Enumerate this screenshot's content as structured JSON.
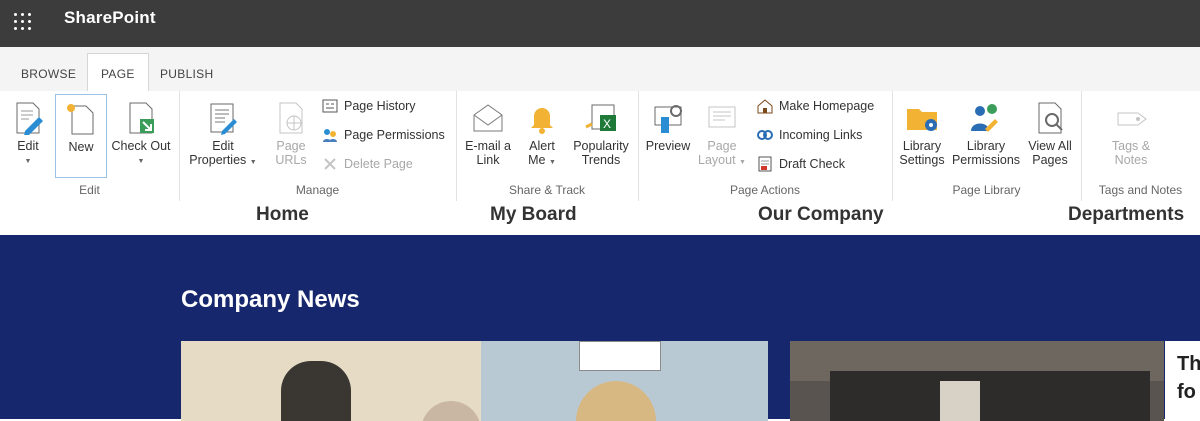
{
  "suite": {
    "app_name": "SharePoint"
  },
  "tabs": [
    {
      "label": "BROWSE",
      "active": false
    },
    {
      "label": "PAGE",
      "active": true
    },
    {
      "label": "PUBLISH",
      "active": false
    }
  ],
  "ribbon": {
    "edit_group": {
      "label": "Edit",
      "edit": "Edit",
      "new": "New",
      "check_out": "Check Out"
    },
    "manage_group": {
      "label": "Manage",
      "edit_properties_1": "Edit",
      "edit_properties_2": "Properties",
      "page_urls_1": "Page",
      "page_urls_2": "URLs",
      "page_history": "Page History",
      "page_permissions": "Page Permissions",
      "delete_page": "Delete Page"
    },
    "share_group": {
      "label": "Share & Track",
      "email_1": "E-mail a",
      "email_2": "Link",
      "alert_1": "Alert",
      "alert_2": "Me",
      "popularity_1": "Popularity",
      "popularity_2": "Trends"
    },
    "actions_group": {
      "label": "Page Actions",
      "preview": "Preview",
      "layout_1": "Page",
      "layout_2": "Layout",
      "make_homepage": "Make Homepage",
      "incoming_links": "Incoming Links",
      "draft_check": "Draft Check"
    },
    "library_group": {
      "label": "Page Library",
      "settings_1": "Library",
      "settings_2": "Settings",
      "permissions_1": "Library",
      "permissions_2": "Permissions",
      "view_all_1": "View All",
      "view_all_2": "Pages"
    },
    "tags_group": {
      "label": "Tags and Notes",
      "tags_1": "Tags &",
      "tags_2": "Notes"
    }
  },
  "nav": {
    "items": [
      "Home",
      "My Board",
      "Our Company",
      "Departments"
    ]
  },
  "hero": {
    "title": "Company News",
    "card2_text_1": "Th",
    "card2_text_2": "fo"
  },
  "colors": {
    "suite_bar": "#3c3c3c",
    "hero_bg": "#16276e",
    "accent": "#2a8dd4"
  }
}
